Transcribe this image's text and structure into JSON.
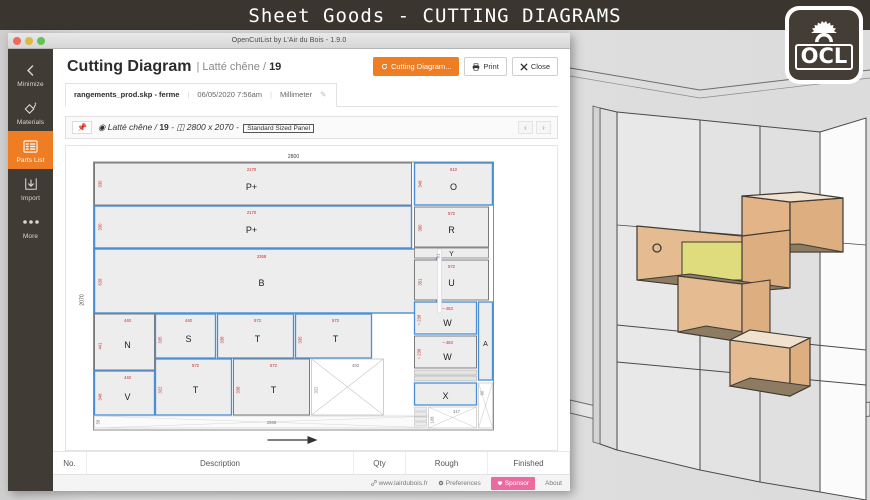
{
  "poster": {
    "title": "Sheet Goods - CUTTING DIAGRAMS"
  },
  "logo": {
    "text": "OCL",
    "icon": "saw-blade-icon"
  },
  "window": {
    "titlebar": "OpenCutList by L'Air du Bois - 1.9.0",
    "lights": [
      "close",
      "minimize",
      "zoom"
    ]
  },
  "sidebar": {
    "items": [
      {
        "label": "Minimize",
        "icon": "chevron-left-icon",
        "active": false
      },
      {
        "label": "Materials",
        "icon": "paint-bucket-icon",
        "active": false
      },
      {
        "label": "Parts List",
        "icon": "list-icon",
        "active": true
      },
      {
        "label": "Import",
        "icon": "download-icon",
        "active": false
      },
      {
        "label": "More",
        "icon": "ellipsis-icon",
        "active": false
      }
    ]
  },
  "header": {
    "title": "Cutting Diagram",
    "separator": "|",
    "material": "Latté chêne",
    "slash": "/",
    "count": "19",
    "actions": [
      {
        "label": "Cutting Diagram...",
        "icon": "refresh-icon",
        "primary": true
      },
      {
        "label": "Print",
        "icon": "printer-icon",
        "primary": false
      },
      {
        "label": "Close",
        "icon": "close-x-icon",
        "primary": false
      }
    ]
  },
  "file_bar": {
    "file_name": "rangements_prod.skp - ferme",
    "timestamp": "06/05/2020 7:56am",
    "unit": "Millimeter",
    "edit_icon": "pencil-icon"
  },
  "breadcrumb": {
    "pin_icon": "pin-icon",
    "material_icon": "material-icon",
    "material": "Latté chêne",
    "slash": "/",
    "count": "19",
    "dash1": "-",
    "size_icon": "panel-size-icon",
    "size": "2800 x 2070",
    "dash2": "-",
    "badge": "Standard Sized Panel",
    "prev": "‹",
    "next": "›"
  },
  "diagram": {
    "panel_width": "2800",
    "panel_height": "2070",
    "bottom_width": "2568",
    "arrow_label": "grain-direction-arrow",
    "parts": [
      {
        "label": "P+",
        "w": "2170",
        "h": "330"
      },
      {
        "label": "P+",
        "w": "2170",
        "h": "330"
      },
      {
        "label": "B",
        "w": "2368",
        "h": "628"
      },
      {
        "label": "N",
        "w": "440",
        "h": "441"
      },
      {
        "label": "S",
        "w": "440",
        "h": "335"
      },
      {
        "label": "T",
        "w": "572",
        "h": "338"
      },
      {
        "label": "T",
        "w": "572",
        "h": "335"
      },
      {
        "label": "V",
        "w": "440",
        "h": "348"
      },
      {
        "label": "T",
        "w": "572",
        "h": "322"
      },
      {
        "label": "T",
        "w": "572",
        "h": "338"
      },
      {
        "label": "O",
        "w": "610",
        "h": "348"
      },
      {
        "label": "R",
        "w": "572",
        "h": "380"
      },
      {
        "label": "Y",
        "w": "",
        "h": ""
      },
      {
        "label": "U",
        "w": "572",
        "h": "351"
      },
      {
        "label": "W",
        "w": "463",
        "h": "238"
      },
      {
        "label": "W",
        "w": "463",
        "h": "238"
      },
      {
        "label": "X",
        "w": "",
        "h": ""
      },
      {
        "label": "A",
        "w": "",
        "h": ""
      }
    ],
    "offcut_labels": [
      "493",
      "317",
      "81",
      "90"
    ]
  },
  "table": {
    "columns": [
      "No.",
      "Description",
      "Qty",
      "Rough",
      "Finished"
    ]
  },
  "footer": {
    "website": "www.lairdubois.fr",
    "preferences": "Preferences",
    "sponsor": "Sponsor",
    "about": "About",
    "website_icon": "link-icon",
    "preferences_icon": "gear-icon",
    "sponsor_icon": "heart-icon"
  },
  "colors": {
    "accent": "#ee7d23",
    "sidebar": "#413b35",
    "sponsor": "#ec6aa0",
    "dim_red": "#cc2a2a",
    "part_stroke": "#4a8fd6",
    "poster_bg": "#3b352f"
  }
}
